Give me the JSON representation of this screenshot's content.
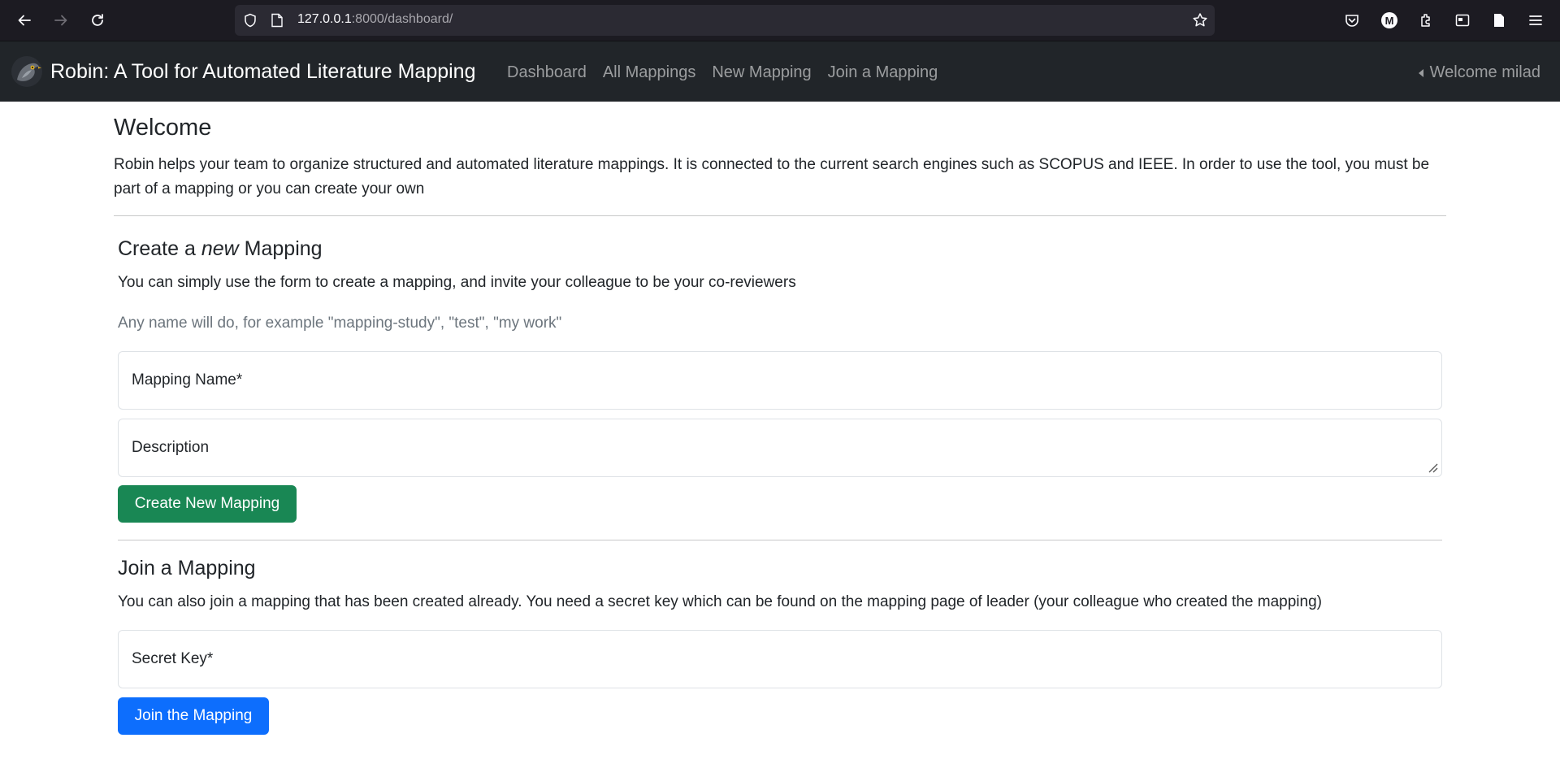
{
  "browser": {
    "url_host": "127.0.0.1",
    "url_path": ":8000/dashboard/",
    "profile_initial": "M"
  },
  "navbar": {
    "brand": "Robin: A Tool for Automated Literature Mapping",
    "links": [
      "Dashboard",
      "All Mappings",
      "New Mapping",
      "Join a Mapping"
    ],
    "welcome": "Welcome milad"
  },
  "intro": {
    "title": "Welcome",
    "text": "Robin helps your team to organize structured and automated literature mappings. It is connected to the current search engines such as SCOPUS and IEEE. In order to use the tool, you must be part of a mapping or you can create your own"
  },
  "create": {
    "title_pre": "Create a ",
    "title_em": "new",
    "title_post": " Mapping",
    "text": "You can simply use the form to create a mapping, and invite your colleague to be your co-reviewers",
    "hint": "Any name will do, for example \"mapping-study\", \"test\", \"my work\"",
    "name_label": "Mapping Name*",
    "description_label": "Description",
    "button": "Create New Mapping"
  },
  "join": {
    "title": "Join a Mapping",
    "text": "You can also join a mapping that has been created already. You need a secret key which can be found on the mapping page of leader (your colleague who created the mapping)",
    "key_label": "Secret Key*",
    "button": "Join the Mapping"
  },
  "colors": {
    "navbar_bg": "#212529",
    "create_button": "#198754",
    "join_button": "#0d6efd",
    "browser_bg": "#1c1b22"
  }
}
